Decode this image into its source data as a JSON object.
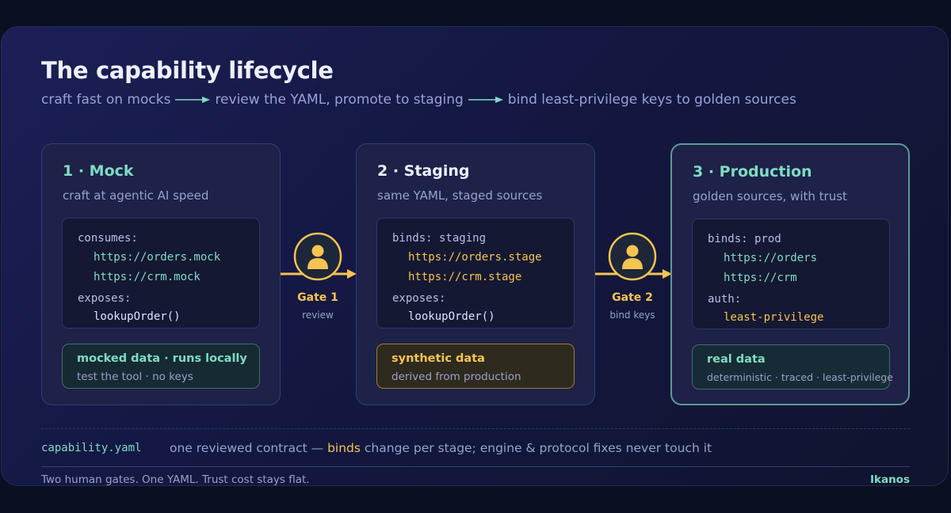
{
  "header": {
    "title": "The capability lifecycle",
    "subtitle_step1": "craft fast on mocks",
    "subtitle_step2": "review the YAML, promote to staging",
    "subtitle_step3": "bind least-privilege keys to golden sources"
  },
  "stages": [
    {
      "title": "1 · Mock",
      "subtitle": "craft at agentic AI speed",
      "code": {
        "line1_key": "consumes:",
        "line2": "https://orders.mock",
        "line3": "https://crm.mock",
        "line4_key": "exposes:",
        "line5": "lookupOrder()"
      },
      "note_title": "mocked data · runs locally",
      "note_sub": "test the tool · no keys"
    },
    {
      "title": "2 · Staging",
      "subtitle": "same YAML, staged sources",
      "code": {
        "line1_key": "binds: staging",
        "line2": "https://orders.stage",
        "line3": "https://crm.stage",
        "line4_key": "exposes:",
        "line5": "lookupOrder()"
      },
      "note_title": "synthetic data",
      "note_sub": "derived from production"
    },
    {
      "title": "3 · Production",
      "subtitle": "golden sources, with trust",
      "code": {
        "line1_key": "binds: prod",
        "line2": "https://orders",
        "line3": "https://crm",
        "line4_key": "auth:",
        "line5": "least-privilege"
      },
      "note_title": "real data",
      "note_sub": "deterministic · traced · least-privilege"
    }
  ],
  "gates": [
    {
      "label": "Gate 1",
      "sub": "review"
    },
    {
      "label": "Gate 2",
      "sub": "bind keys"
    }
  ],
  "contract": {
    "file": "capability.yaml",
    "text_before": "one reviewed contract — ",
    "highlight": "binds",
    "text_after": " change per stage; engine & protocol fixes never touch it"
  },
  "footer": {
    "left": "Two human gates. One YAML. Trust cost stays flat.",
    "brand": "Ikanos"
  },
  "colors": {
    "accent_mint": "#7fdcc3",
    "accent_amber": "#f5c451",
    "background": "#0b0f22"
  },
  "icons": [
    "arrow-right-icon",
    "user-icon"
  ]
}
